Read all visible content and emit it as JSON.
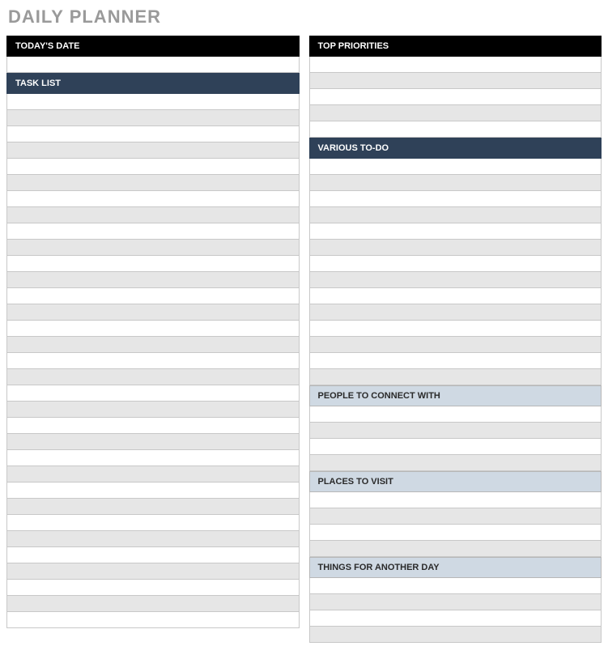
{
  "page_title": "DAILY PLANNER",
  "left": {
    "todays_date": {
      "label": "TODAY'S DATE",
      "value": ""
    },
    "task_list": {
      "label": "TASK LIST",
      "rows": [
        "",
        "",
        "",
        "",
        "",
        "",
        "",
        "",
        "",
        "",
        "",
        "",
        "",
        "",
        "",
        "",
        "",
        "",
        "",
        "",
        "",
        "",
        "",
        "",
        "",
        "",
        "",
        "",
        "",
        "",
        "",
        "",
        ""
      ]
    }
  },
  "right": {
    "top_priorities": {
      "label": "TOP PRIORITIES",
      "rows": [
        "",
        "",
        "",
        "",
        ""
      ]
    },
    "various_todo": {
      "label": "VARIOUS TO-DO",
      "rows": [
        "",
        "",
        "",
        "",
        "",
        "",
        "",
        "",
        "",
        "",
        "",
        "",
        "",
        ""
      ]
    },
    "people_to_connect": {
      "label": "PEOPLE TO CONNECT WITH",
      "rows": [
        "",
        "",
        "",
        ""
      ]
    },
    "places_to_visit": {
      "label": "PLACES TO VISIT",
      "rows": [
        "",
        "",
        "",
        ""
      ]
    },
    "things_another_day": {
      "label": "THINGS FOR ANOTHER DAY",
      "rows": [
        "",
        "",
        "",
        ""
      ]
    }
  }
}
